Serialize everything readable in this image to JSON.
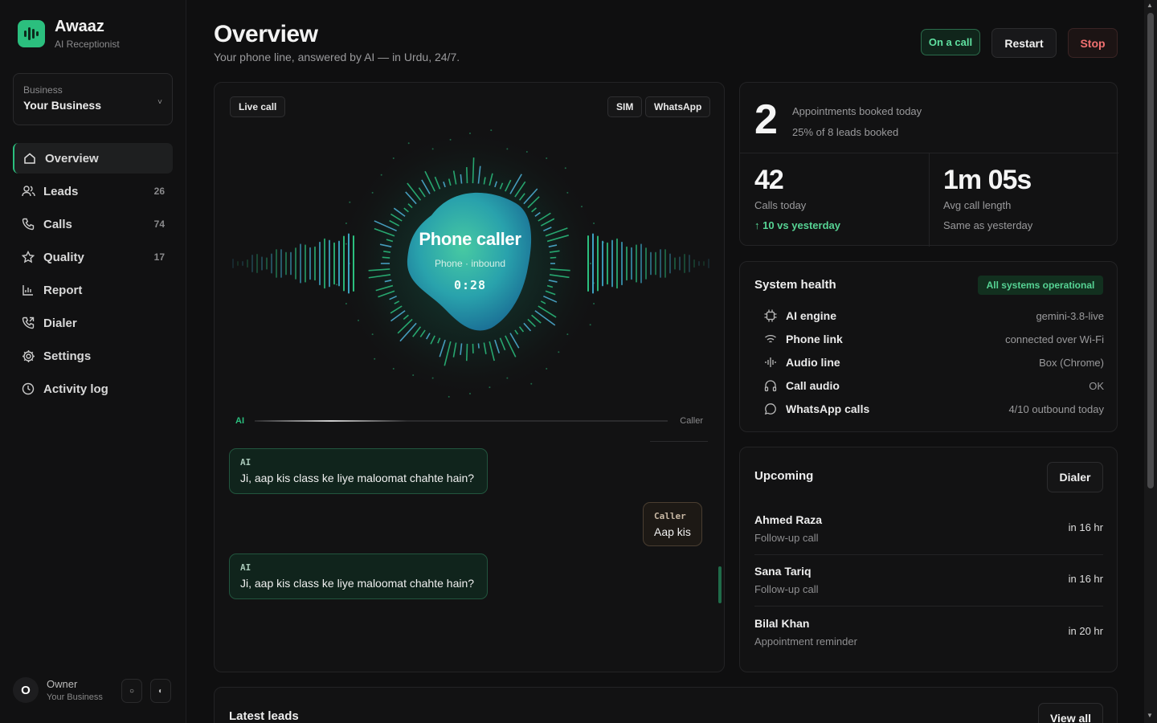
{
  "brand": {
    "name": "Awaaz",
    "subtitle": "AI Receptionist"
  },
  "business": {
    "label": "Business",
    "value": "Your Business"
  },
  "nav": [
    {
      "label": "Overview",
      "count": "",
      "icon": "home-icon"
    },
    {
      "label": "Leads",
      "count": "26",
      "icon": "users-icon"
    },
    {
      "label": "Calls",
      "count": "74",
      "icon": "phone-icon"
    },
    {
      "label": "Quality",
      "count": "17",
      "icon": "star-icon"
    },
    {
      "label": "Report",
      "count": "",
      "icon": "bar-chart-icon"
    },
    {
      "label": "Dialer",
      "count": "",
      "icon": "phone-outgoing-icon"
    },
    {
      "label": "Settings",
      "count": "",
      "icon": "gear-icon"
    },
    {
      "label": "Activity log",
      "count": "",
      "icon": "clock-icon"
    }
  ],
  "owner": {
    "initial": "O",
    "name": "Owner",
    "business": "Your Business"
  },
  "header": {
    "title": "Overview",
    "subtitle": "Your phone line, answered by AI — in Urdu, 24/7.",
    "status": "On a call",
    "restart": "Restart",
    "stop": "Stop"
  },
  "live": {
    "badge": "Live call",
    "chip_sim": "SIM",
    "chip_whatsapp": "WhatsApp",
    "caller_title": "Phone caller",
    "caller_sub": "Phone · inbound",
    "timer": "0:28",
    "ai_label": "AI",
    "caller_label": "Caller",
    "accent": "#2bbf7e",
    "transcript": [
      {
        "speaker": "AI",
        "text": "Ji, aap kis class ke liye maloomat chahte hain?"
      },
      {
        "speaker": "Caller",
        "text": "Aap kis"
      },
      {
        "speaker": "AI",
        "text": "Ji, aap kis class ke liye maloomat chahte hain?"
      }
    ]
  },
  "stats": {
    "appointments": {
      "value": "2",
      "label": "Appointments booked today",
      "sub": "25% of 8 leads booked"
    },
    "calls": {
      "value": "42",
      "label": "Calls today",
      "trend": "↑ 10 vs yesterday"
    },
    "avg": {
      "value": "1m 05s",
      "label": "Avg call length",
      "trend": "Same as yesterday"
    }
  },
  "health": {
    "title": "System health",
    "badge": "All systems operational",
    "rows": [
      {
        "name": "AI engine",
        "value": "gemini-3.8-live",
        "icon": "cpu-icon"
      },
      {
        "name": "Phone link",
        "value": "connected over Wi-Fi",
        "icon": "wifi-icon"
      },
      {
        "name": "Audio line",
        "value": "Box (Chrome)",
        "icon": "audio-wave-icon"
      },
      {
        "name": "Call audio",
        "value": "OK",
        "icon": "headphones-icon"
      },
      {
        "name": "WhatsApp calls",
        "value": "4/10 outbound today",
        "icon": "chat-icon"
      }
    ]
  },
  "upcoming": {
    "title": "Upcoming",
    "button": "Dialer",
    "items": [
      {
        "name": "Ahmed Raza",
        "type": "Follow-up call",
        "time": "in 16 hr"
      },
      {
        "name": "Sana Tariq",
        "type": "Follow-up call",
        "time": "in 16 hr"
      },
      {
        "name": "Bilal Khan",
        "type": "Appointment reminder",
        "time": "in 20 hr"
      }
    ]
  },
  "leads": {
    "title": "Latest leads",
    "button": "View all"
  }
}
